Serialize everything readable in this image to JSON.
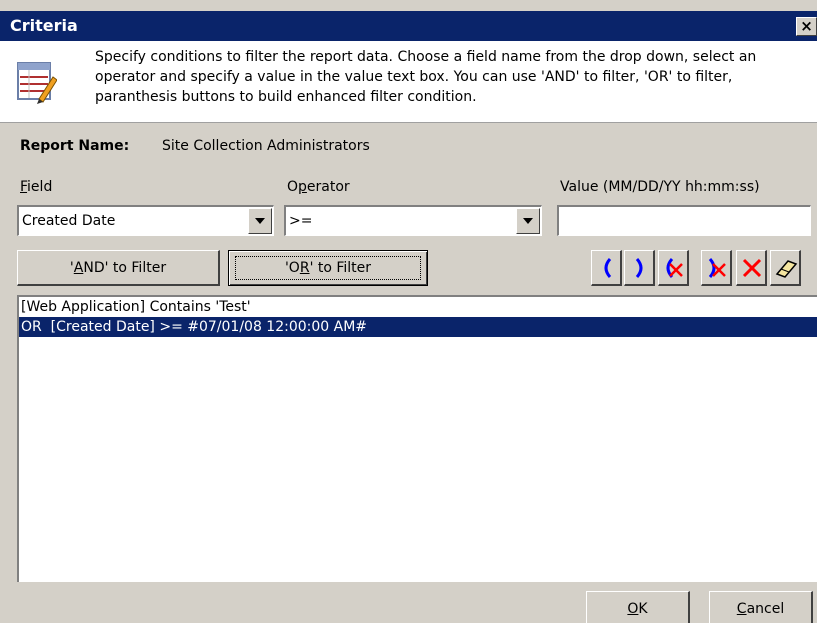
{
  "window": {
    "title": "Criteria",
    "close_label": "×"
  },
  "info": {
    "icon": "table-edit-icon",
    "text": "Specify conditions to filter the report data. Choose a field name from the drop down, select an operator and specify a value in the value text box. You can use 'AND' to filter, 'OR' to filter, paranthesis buttons to build enhanced filter condition."
  },
  "report": {
    "label": "Report Name:",
    "value": "Site Collection Administrators"
  },
  "form": {
    "field_label_accel": "F",
    "field_label_rest": "ield",
    "field_value": "Created Date",
    "operator_label_pre": "O",
    "operator_label_accel": "p",
    "operator_label_rest": "erator",
    "operator_value": ">=",
    "value_label": "Value (MM/DD/YY hh:mm:ss)",
    "value_value": ""
  },
  "buttons": {
    "and_pre": "'",
    "and_accel": "A",
    "and_rest": "ND' to Filter",
    "or_pre": "'O",
    "or_accel": "R",
    "or_rest": "' to Filter",
    "ok_accel": "O",
    "ok_rest": "K",
    "cancel_accel": "C",
    "cancel_rest": "ancel"
  },
  "toolbar": {
    "icons": [
      "open-paren-icon",
      "close-paren-icon",
      "remove-open-paren-icon",
      "remove-close-paren-icon",
      "delete-icon",
      "eraser-icon"
    ],
    "colors": {
      "paren": "#0000ff",
      "delete": "#ff0000"
    }
  },
  "criteria_list": [
    {
      "text": "[Web Application] Contains 'Test'",
      "selected": false
    },
    {
      "text": "OR  [Created Date] >= #07/01/08 12:00:00 AM#",
      "selected": true
    }
  ],
  "colors": {
    "titlebar": "#0a246a",
    "selection": "#0a246a",
    "face": "#d4d0c8"
  }
}
